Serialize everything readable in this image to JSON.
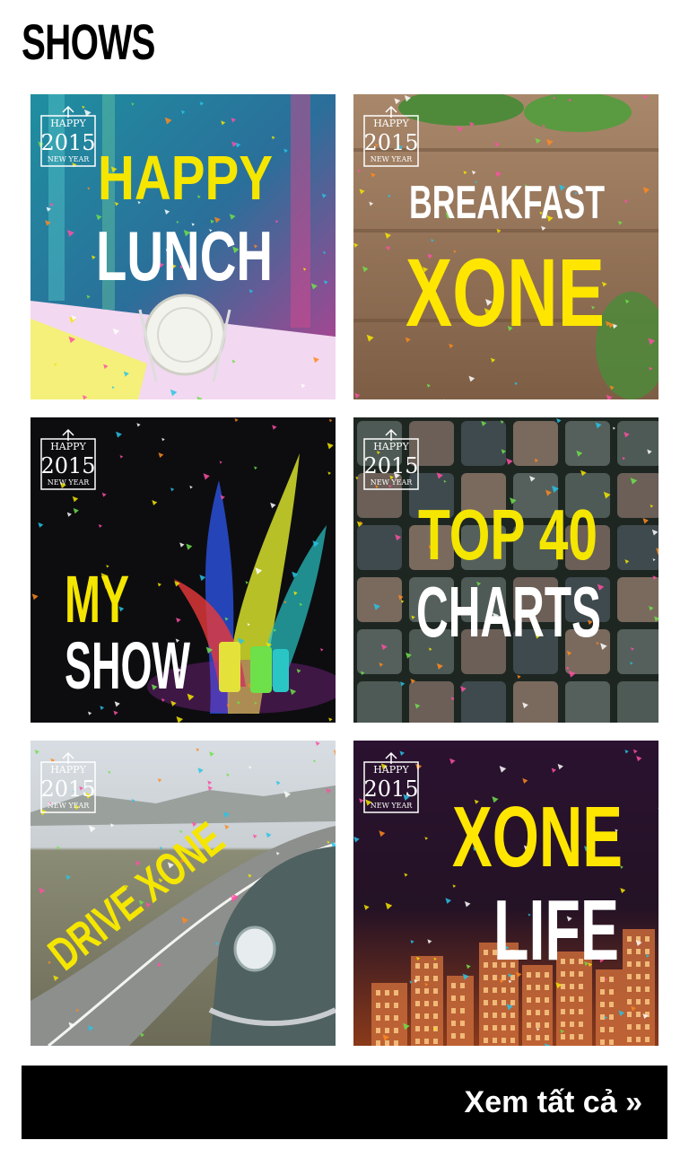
{
  "section": {
    "title": "SHOWS"
  },
  "badge": {
    "top": "HAPPY",
    "year": "2015",
    "bottom": "NEW YEAR"
  },
  "shows": [
    {
      "line1": "HAPPY",
      "line2": "LUNCH",
      "color1": "#f5e600",
      "color2": "#ffffff"
    },
    {
      "line1": "BREAKFAST",
      "line2": "XONE",
      "color1": "#ffffff",
      "color2": "#ffe600"
    },
    {
      "line1": "MY",
      "line2": "SHOW",
      "color1": "#f5e600",
      "color2": "#ffffff"
    },
    {
      "line1": "TOP 40",
      "line2": "CHARTS",
      "color1": "#f5e600",
      "color2": "#ffffff"
    },
    {
      "line1": "DRIVE XONE",
      "color1": "#f5e600"
    },
    {
      "line1": "XONE",
      "line2": "LIFE",
      "color1": "#ffe600",
      "color2": "#ffffff"
    }
  ],
  "cta": {
    "label": "Xem tất cả »"
  }
}
